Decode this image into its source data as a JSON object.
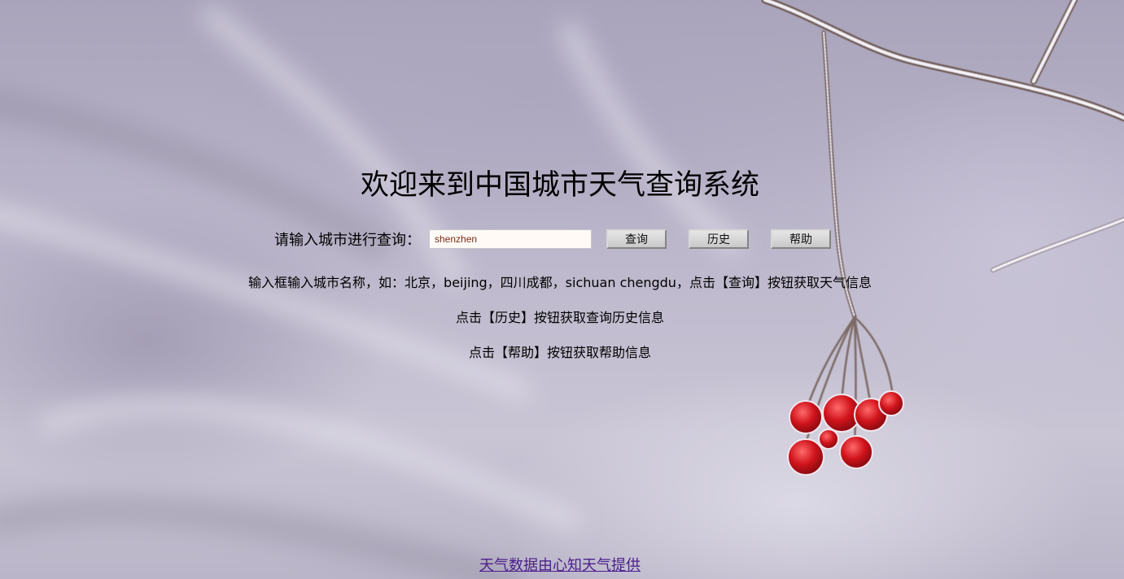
{
  "page": {
    "title": "欢迎来到中国城市天气查询系统"
  },
  "search": {
    "label": "请输入城市进行查询：",
    "value": "shenzhen",
    "query_button": "查询",
    "history_button": "历史",
    "help_button": "帮助"
  },
  "instructions": [
    "输入框输入城市名称，如：北京，beijing，四川成都，sichuan chengdu，点击【查询】按钮获取天气信息",
    "点击【历史】按钮获取查询历史信息",
    "点击【帮助】按钮获取帮助信息"
  ],
  "footer": {
    "link_text": "天气数据由心知天气提供"
  },
  "colors": {
    "link": "#4b1f8c",
    "input_text": "#7a2a18",
    "berry": "#c8141c"
  }
}
